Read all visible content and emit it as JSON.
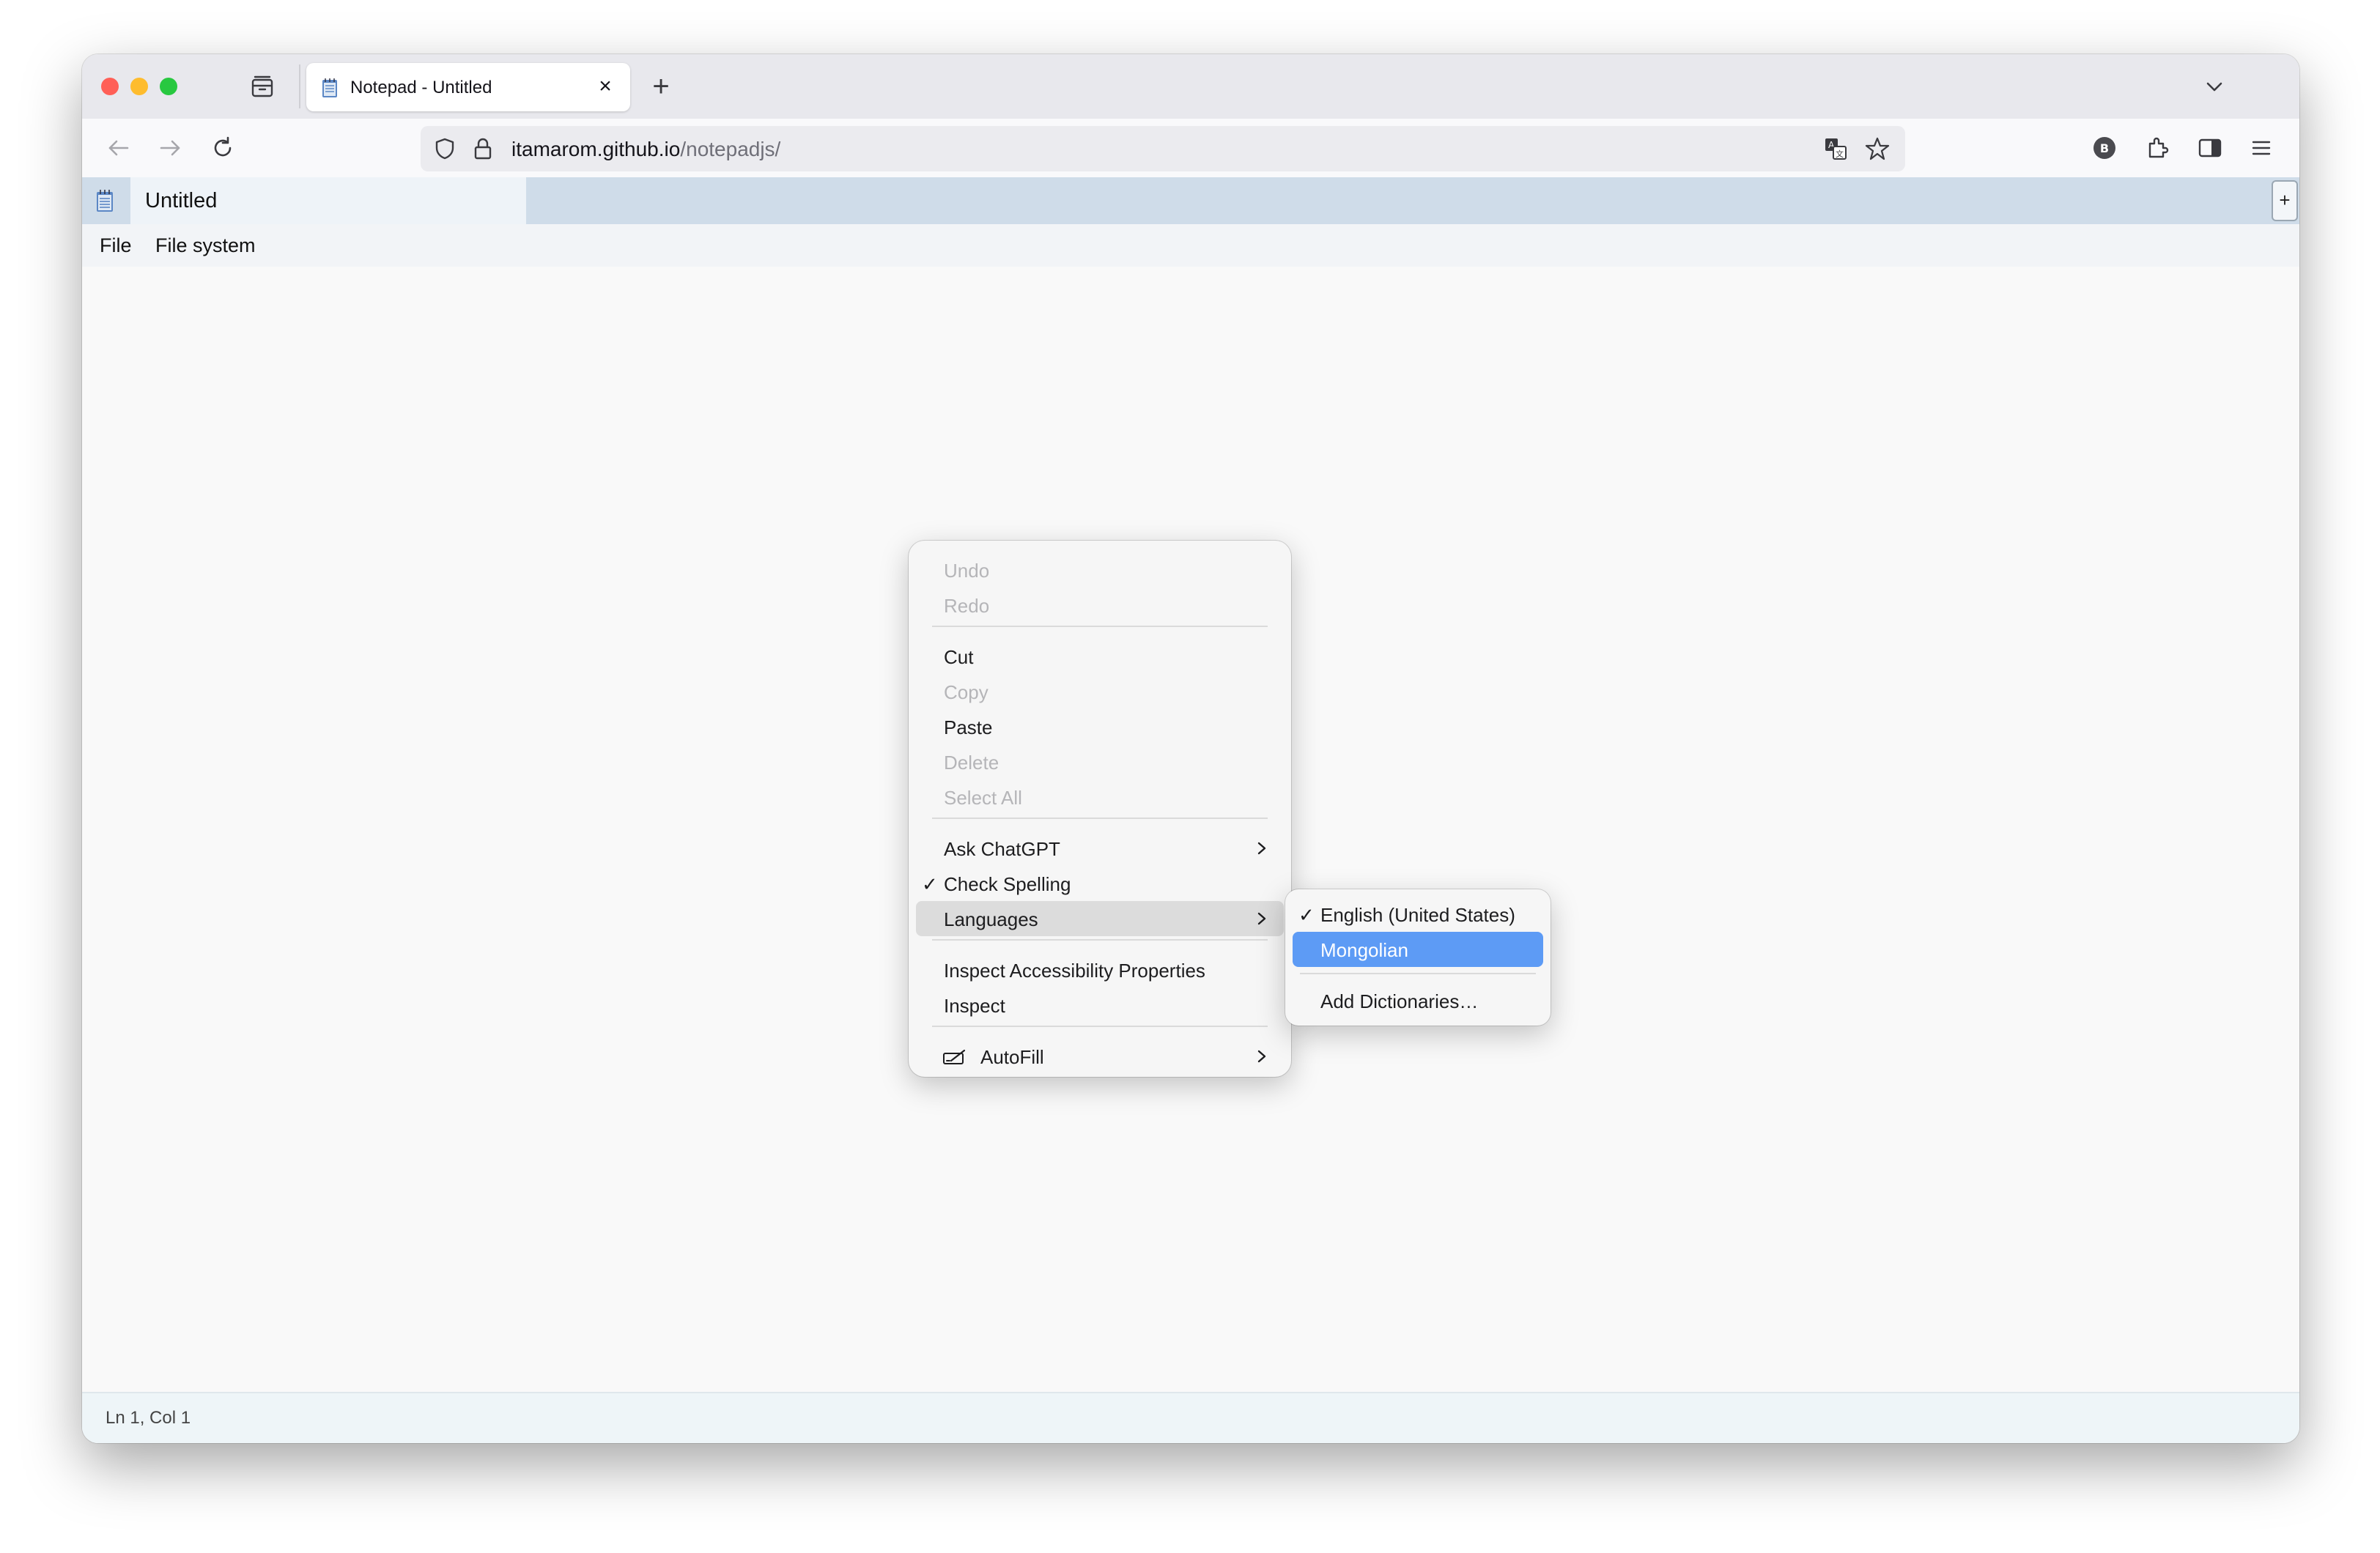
{
  "browser": {
    "tab_title": "Notepad - Untitled",
    "url_host": "itamarom.github.io",
    "url_path": "/notepadjs/",
    "account_initial": "B"
  },
  "app": {
    "doc_tab_title": "Untitled",
    "add_tab_label": "+",
    "menus": [
      "File",
      "File system"
    ],
    "status": "Ln 1, Col 1"
  },
  "context_menu": {
    "undo": "Undo",
    "redo": "Redo",
    "cut": "Cut",
    "copy": "Copy",
    "paste": "Paste",
    "delete": "Delete",
    "select_all": "Select All",
    "ask_chatgpt": "Ask ChatGPT",
    "check_spelling": "Check Spelling",
    "languages": "Languages",
    "inspect_accessibility": "Inspect Accessibility Properties",
    "inspect": "Inspect",
    "autofill": "AutoFill",
    "checkmark": "✓"
  },
  "languages_submenu": {
    "english": "English (United States)",
    "mongolian": "Mongolian",
    "add_dictionaries": "Add Dictionaries…"
  },
  "colors": {
    "highlight": "#5d9bf5",
    "app_tabbar": "#cfdce9"
  }
}
